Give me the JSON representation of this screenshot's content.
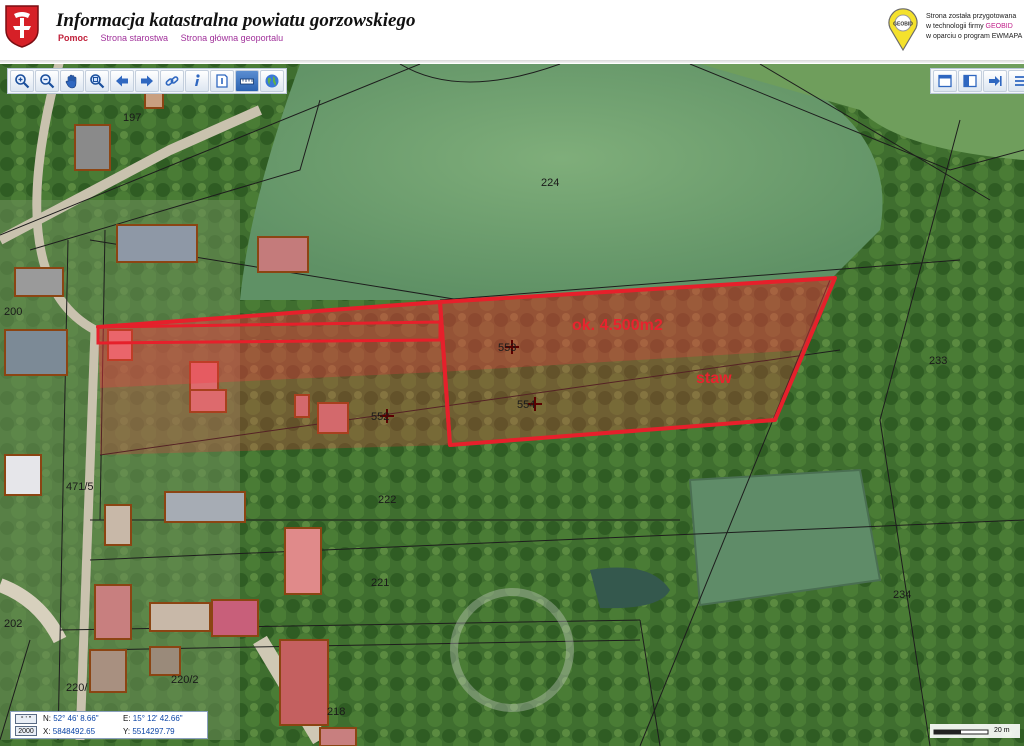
{
  "header": {
    "title": "Informacja katastralna powiatu gorzowskiego",
    "nav": [
      "Pomoc",
      "Strona starostwa",
      "Strona główna geoportalu"
    ],
    "logo_text": "GEOBID",
    "note_line1": "Strona została przygotowana",
    "note_line2_prefix": "w technologii firmy ",
    "note_brand": "GEOBID",
    "note_line3": "w oparciu o program EWMAPA"
  },
  "toolbar": {
    "left_tools": [
      "zoom-in-icon",
      "zoom-out-icon",
      "hand-pan-icon",
      "zoom-extent-icon",
      "arrow-left-icon",
      "arrow-right-icon",
      "link-icon",
      "info-icon",
      "identify-icon",
      "measure-icon",
      "globe-icon"
    ],
    "right_tools": [
      "window-icon",
      "split-panel-icon",
      "export-icon",
      "list-icon"
    ]
  },
  "map": {
    "parcels": {
      "p197": "197",
      "p224": "224",
      "p200": "200",
      "p233": "233",
      "p553": "553",
      "p554": "554",
      "p552": "552",
      "p471": "471/5",
      "p222": "222",
      "p221": "221",
      "p202": "202",
      "p234": "234",
      "p220a": "220/",
      "p220b": "220/2",
      "p218": "218"
    },
    "annotations": {
      "area": "ok. 4.500m2",
      "pond": "staw"
    },
    "colors": {
      "highlight_stroke": "#e6202b",
      "highlight_fill": "#ff3340",
      "building_stroke": "#8b4513"
    }
  },
  "coords": {
    "badge_top": "° ' \"",
    "badge_bottom": "2000",
    "n_label": "N:",
    "n_value": "52° 46' 8.66\"",
    "e_label": "E:",
    "e_value": "15° 12' 42.66\"",
    "x_label": "X:",
    "x_value": "5848492.65",
    "y_label": "Y:",
    "y_value": "5514297.79"
  },
  "scale": {
    "label": "20 m"
  }
}
